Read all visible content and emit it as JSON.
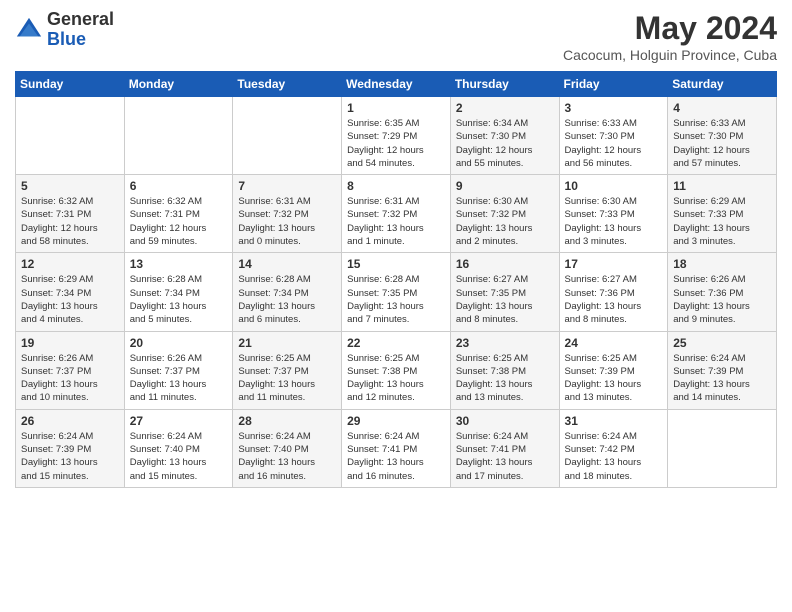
{
  "logo": {
    "general": "General",
    "blue": "Blue"
  },
  "title": "May 2024",
  "location": "Cacocum, Holguin Province, Cuba",
  "days_of_week": [
    "Sunday",
    "Monday",
    "Tuesday",
    "Wednesday",
    "Thursday",
    "Friday",
    "Saturday"
  ],
  "weeks": [
    [
      {
        "day": "",
        "info": ""
      },
      {
        "day": "",
        "info": ""
      },
      {
        "day": "",
        "info": ""
      },
      {
        "day": "1",
        "info": "Sunrise: 6:35 AM\nSunset: 7:29 PM\nDaylight: 12 hours\nand 54 minutes."
      },
      {
        "day": "2",
        "info": "Sunrise: 6:34 AM\nSunset: 7:30 PM\nDaylight: 12 hours\nand 55 minutes."
      },
      {
        "day": "3",
        "info": "Sunrise: 6:33 AM\nSunset: 7:30 PM\nDaylight: 12 hours\nand 56 minutes."
      },
      {
        "day": "4",
        "info": "Sunrise: 6:33 AM\nSunset: 7:30 PM\nDaylight: 12 hours\nand 57 minutes."
      }
    ],
    [
      {
        "day": "5",
        "info": "Sunrise: 6:32 AM\nSunset: 7:31 PM\nDaylight: 12 hours\nand 58 minutes."
      },
      {
        "day": "6",
        "info": "Sunrise: 6:32 AM\nSunset: 7:31 PM\nDaylight: 12 hours\nand 59 minutes."
      },
      {
        "day": "7",
        "info": "Sunrise: 6:31 AM\nSunset: 7:32 PM\nDaylight: 13 hours\nand 0 minutes."
      },
      {
        "day": "8",
        "info": "Sunrise: 6:31 AM\nSunset: 7:32 PM\nDaylight: 13 hours\nand 1 minute."
      },
      {
        "day": "9",
        "info": "Sunrise: 6:30 AM\nSunset: 7:32 PM\nDaylight: 13 hours\nand 2 minutes."
      },
      {
        "day": "10",
        "info": "Sunrise: 6:30 AM\nSunset: 7:33 PM\nDaylight: 13 hours\nand 3 minutes."
      },
      {
        "day": "11",
        "info": "Sunrise: 6:29 AM\nSunset: 7:33 PM\nDaylight: 13 hours\nand 3 minutes."
      }
    ],
    [
      {
        "day": "12",
        "info": "Sunrise: 6:29 AM\nSunset: 7:34 PM\nDaylight: 13 hours\nand 4 minutes."
      },
      {
        "day": "13",
        "info": "Sunrise: 6:28 AM\nSunset: 7:34 PM\nDaylight: 13 hours\nand 5 minutes."
      },
      {
        "day": "14",
        "info": "Sunrise: 6:28 AM\nSunset: 7:34 PM\nDaylight: 13 hours\nand 6 minutes."
      },
      {
        "day": "15",
        "info": "Sunrise: 6:28 AM\nSunset: 7:35 PM\nDaylight: 13 hours\nand 7 minutes."
      },
      {
        "day": "16",
        "info": "Sunrise: 6:27 AM\nSunset: 7:35 PM\nDaylight: 13 hours\nand 8 minutes."
      },
      {
        "day": "17",
        "info": "Sunrise: 6:27 AM\nSunset: 7:36 PM\nDaylight: 13 hours\nand 8 minutes."
      },
      {
        "day": "18",
        "info": "Sunrise: 6:26 AM\nSunset: 7:36 PM\nDaylight: 13 hours\nand 9 minutes."
      }
    ],
    [
      {
        "day": "19",
        "info": "Sunrise: 6:26 AM\nSunset: 7:37 PM\nDaylight: 13 hours\nand 10 minutes."
      },
      {
        "day": "20",
        "info": "Sunrise: 6:26 AM\nSunset: 7:37 PM\nDaylight: 13 hours\nand 11 minutes."
      },
      {
        "day": "21",
        "info": "Sunrise: 6:25 AM\nSunset: 7:37 PM\nDaylight: 13 hours\nand 11 minutes."
      },
      {
        "day": "22",
        "info": "Sunrise: 6:25 AM\nSunset: 7:38 PM\nDaylight: 13 hours\nand 12 minutes."
      },
      {
        "day": "23",
        "info": "Sunrise: 6:25 AM\nSunset: 7:38 PM\nDaylight: 13 hours\nand 13 minutes."
      },
      {
        "day": "24",
        "info": "Sunrise: 6:25 AM\nSunset: 7:39 PM\nDaylight: 13 hours\nand 13 minutes."
      },
      {
        "day": "25",
        "info": "Sunrise: 6:24 AM\nSunset: 7:39 PM\nDaylight: 13 hours\nand 14 minutes."
      }
    ],
    [
      {
        "day": "26",
        "info": "Sunrise: 6:24 AM\nSunset: 7:39 PM\nDaylight: 13 hours\nand 15 minutes."
      },
      {
        "day": "27",
        "info": "Sunrise: 6:24 AM\nSunset: 7:40 PM\nDaylight: 13 hours\nand 15 minutes."
      },
      {
        "day": "28",
        "info": "Sunrise: 6:24 AM\nSunset: 7:40 PM\nDaylight: 13 hours\nand 16 minutes."
      },
      {
        "day": "29",
        "info": "Sunrise: 6:24 AM\nSunset: 7:41 PM\nDaylight: 13 hours\nand 16 minutes."
      },
      {
        "day": "30",
        "info": "Sunrise: 6:24 AM\nSunset: 7:41 PM\nDaylight: 13 hours\nand 17 minutes."
      },
      {
        "day": "31",
        "info": "Sunrise: 6:24 AM\nSunset: 7:42 PM\nDaylight: 13 hours\nand 18 minutes."
      },
      {
        "day": "",
        "info": ""
      }
    ]
  ]
}
